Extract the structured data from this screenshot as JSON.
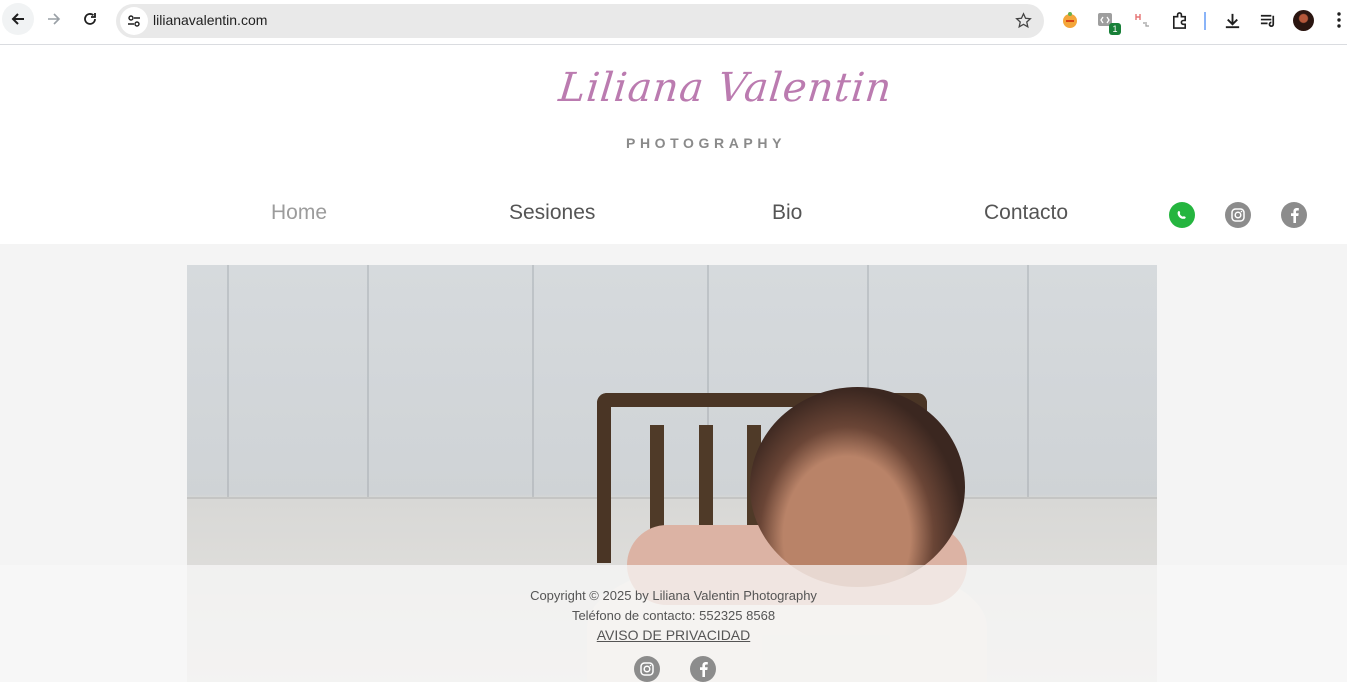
{
  "browser": {
    "url": "lilianavalentin.com",
    "extension_badge": "1"
  },
  "site": {
    "logo_script": "Liliana Valentin",
    "logo_sub": "PHOTOGRAPHY",
    "nav": [
      {
        "label": "Home",
        "active": true
      },
      {
        "label": "Sesiones",
        "active": false
      },
      {
        "label": "Bio",
        "active": false
      },
      {
        "label": "Contacto",
        "active": false
      }
    ],
    "colors": {
      "logo_pink": "#bb7bb0",
      "whatsapp_green": "#25b53f",
      "social_gray": "#8c8c8c"
    }
  },
  "footer": {
    "copyright": "Copyright © 2025 by Liliana Valentin Photography",
    "phone": "Teléfono de contacto: 552325 8568",
    "privacy_link": "AVISO DE PRIVACIDAD"
  }
}
